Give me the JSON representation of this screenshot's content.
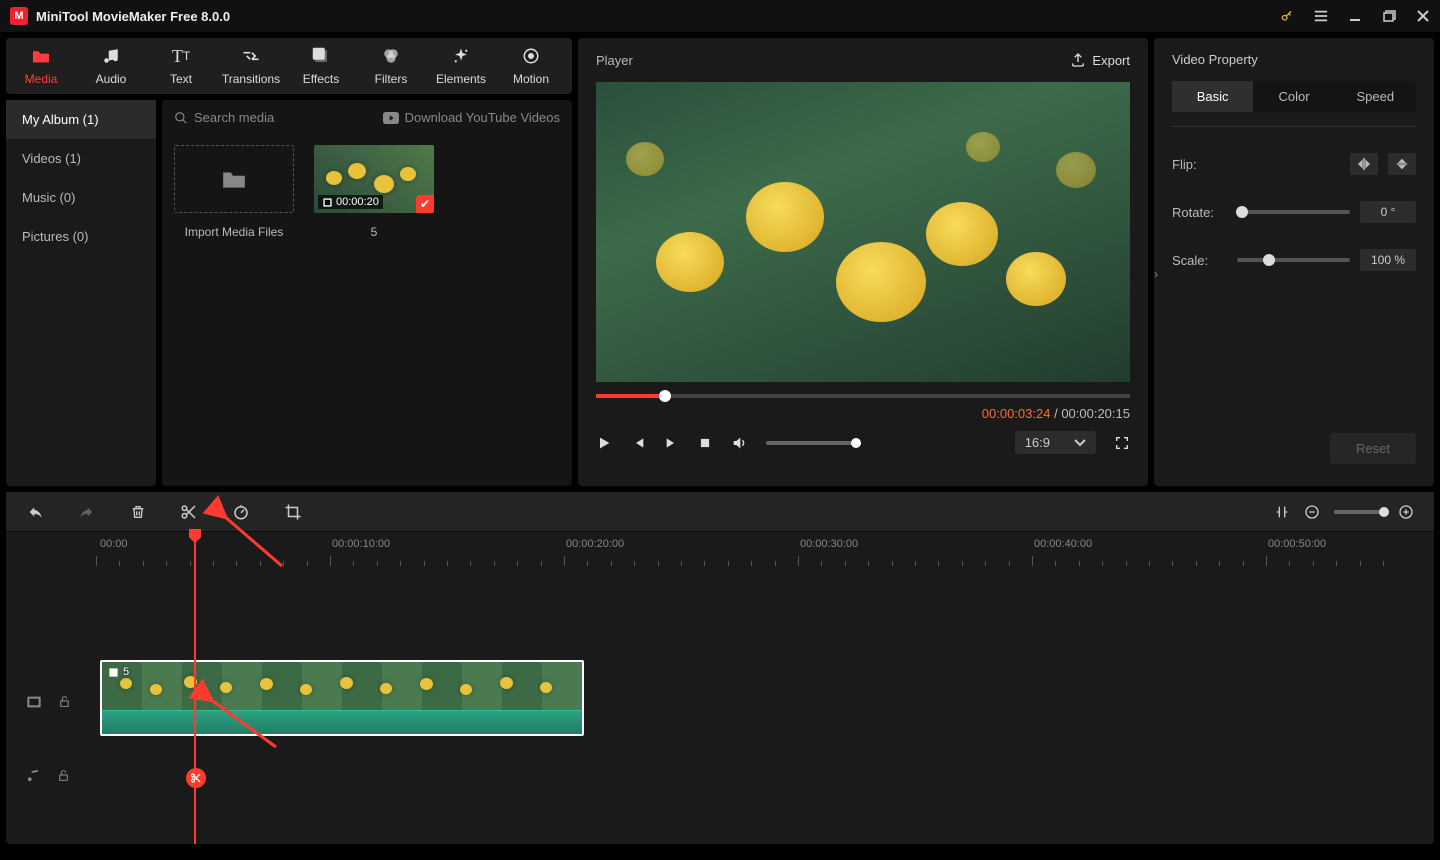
{
  "app": {
    "title": "MiniTool MovieMaker Free 8.0.0"
  },
  "tabs": {
    "media": "Media",
    "audio": "Audio",
    "text": "Text",
    "transitions": "Transitions",
    "effects": "Effects",
    "filters": "Filters",
    "elements": "Elements",
    "motion": "Motion"
  },
  "sidebar": {
    "album": "My Album (1)",
    "videos": "Videos (1)",
    "music": "Music (0)",
    "pictures": "Pictures (0)"
  },
  "media": {
    "search_placeholder": "Search media",
    "download_label": "Download YouTube Videos",
    "import_label": "Import Media Files",
    "clip_duration": "00:00:20",
    "clip_name": "5"
  },
  "player": {
    "title": "Player",
    "export": "Export",
    "current": "00:00:03:24",
    "total": "00:00:20:15",
    "ratio": "16:9"
  },
  "props": {
    "title": "Video Property",
    "tab_basic": "Basic",
    "tab_color": "Color",
    "tab_speed": "Speed",
    "flip": "Flip:",
    "rotate": "Rotate:",
    "scale": "Scale:",
    "rotate_val": "0 °",
    "scale_val": "100 %",
    "reset": "Reset"
  },
  "timeline": {
    "marks": [
      "00:00",
      "00:00:10:00",
      "00:00:20:00",
      "00:00:30:00",
      "00:00:40:00",
      "00:00:50:00"
    ],
    "clip_name": "5"
  }
}
